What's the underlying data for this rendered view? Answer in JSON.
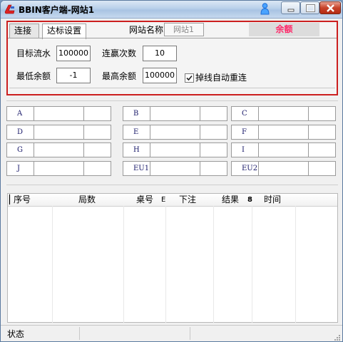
{
  "window": {
    "title": "BBIN客户端-网站1"
  },
  "icons": {
    "app": "app-logo-icon",
    "user": "user-icon",
    "minimize": "minimize-icon",
    "maximize": "maximize-icon",
    "close": "close-icon"
  },
  "tabs": [
    {
      "label": "连接"
    },
    {
      "label": "达标设置"
    }
  ],
  "site": {
    "label": "网站名称",
    "name_value": "网站1",
    "balance_label": "余额"
  },
  "settings": {
    "target_flow_label": "目标流水",
    "target_flow_value": "100000",
    "win_streak_label": "连赢次数",
    "win_streak_value": "10",
    "min_balance_label": "最低余额",
    "min_balance_value": "-1",
    "max_balance_label": "最高余额",
    "max_balance_value": "100000",
    "auto_reconnect_label": "掉线自动重连",
    "auto_reconnect_checked": true
  },
  "grid": {
    "labels": [
      "A",
      "B",
      "C",
      "D",
      "E",
      "F",
      "G",
      "H",
      "I",
      "J",
      "EU1",
      "EU2"
    ]
  },
  "table": {
    "columns": [
      "序号",
      "局数",
      "桌号",
      "E",
      "下注",
      "结果",
      "8",
      "时间"
    ]
  },
  "status": {
    "text": "状态"
  },
  "colors": {
    "accent_border": "#cc1f1f",
    "balance_text": "#ff2a6a"
  }
}
